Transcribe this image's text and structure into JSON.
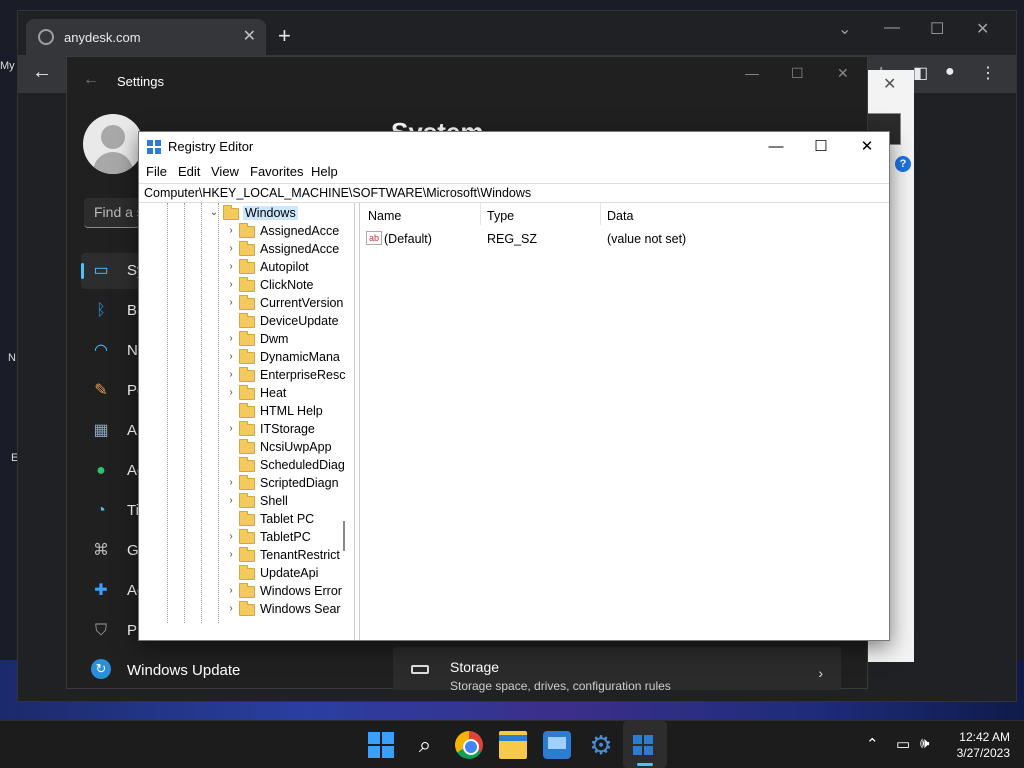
{
  "desktop": {
    "icon_labels": [
      "My",
      "N",
      "E"
    ]
  },
  "chrome": {
    "tab_title": "anydesk.com",
    "tab_close": "✕",
    "new_tab": "+",
    "back_arrow": "←",
    "icons": [
      "star-icon",
      "sidebar-icon",
      "profile-icon",
      "menu-icon"
    ]
  },
  "settings": {
    "window_title": "Settings",
    "back": "←",
    "page_title": "System",
    "search_placeholder": "Find a setting",
    "nav": [
      {
        "label": "System",
        "icon": "monitor-icon",
        "color": "#4cc2ff"
      },
      {
        "label": "Bluetooth & devices",
        "icon": "bluetooth-icon",
        "color": "#2a8fd8"
      },
      {
        "label": "Network & internet",
        "icon": "wifi-icon",
        "color": "#4cc2ff"
      },
      {
        "label": "Personalization",
        "icon": "brush-icon",
        "color": "#e8a24a"
      },
      {
        "label": "Apps",
        "icon": "apps-icon",
        "color": "#8aa4c8"
      },
      {
        "label": "Accounts",
        "icon": "person-icon",
        "color": "#2fbf71"
      },
      {
        "label": "Time & language",
        "icon": "globe-clock-icon",
        "color": "#4cc2ff"
      },
      {
        "label": "Gaming",
        "icon": "gamepad-icon",
        "color": "#bbbbbb"
      },
      {
        "label": "Accessibility",
        "icon": "accessibility-icon",
        "color": "#3aa0ff"
      },
      {
        "label": "Privacy & security",
        "icon": "shield-icon",
        "color": "#9aa0a6"
      }
    ],
    "windows_update": "Windows Update",
    "storage_title": "Storage",
    "storage_desc": "Storage space, drives, configuration rules"
  },
  "regedit": {
    "title": "Registry Editor",
    "menu": [
      "File",
      "Edit",
      "View",
      "Favorites",
      "Help"
    ],
    "address": "Computer\\HKEY_LOCAL_MACHINE\\SOFTWARE\\Microsoft\\Windows",
    "tree_root": "Windows",
    "tree_items": [
      {
        "label": "AssignedAcce",
        "expandable": true
      },
      {
        "label": "AssignedAcce",
        "expandable": true
      },
      {
        "label": "Autopilot",
        "expandable": true
      },
      {
        "label": "ClickNote",
        "expandable": true
      },
      {
        "label": "CurrentVersion",
        "expandable": true
      },
      {
        "label": "DeviceUpdate",
        "expandable": false
      },
      {
        "label": "Dwm",
        "expandable": true
      },
      {
        "label": "DynamicMana",
        "expandable": true
      },
      {
        "label": "EnterpriseResc",
        "expandable": true
      },
      {
        "label": "Heat",
        "expandable": true
      },
      {
        "label": "HTML Help",
        "expandable": false
      },
      {
        "label": "ITStorage",
        "expandable": true
      },
      {
        "label": "NcsiUwpApp",
        "expandable": false
      },
      {
        "label": "ScheduledDiag",
        "expandable": false
      },
      {
        "label": "ScriptedDiagn",
        "expandable": true
      },
      {
        "label": "Shell",
        "expandable": true
      },
      {
        "label": "Tablet PC",
        "expandable": false
      },
      {
        "label": "TabletPC",
        "expandable": true
      },
      {
        "label": "TenantRestrict",
        "expandable": true
      },
      {
        "label": "UpdateApi",
        "expandable": false
      },
      {
        "label": "Windows Error",
        "expandable": true
      },
      {
        "label": "Windows Sear",
        "expandable": true
      }
    ],
    "columns": [
      "Name",
      "Type",
      "Data"
    ],
    "values": [
      {
        "name": "(Default)",
        "type": "REG_SZ",
        "data": "(value not set)"
      }
    ]
  },
  "taskbar": {
    "apps": [
      "start-icon",
      "search-icon",
      "chrome-icon",
      "file-explorer-icon",
      "remote-desktop-icon",
      "settings-icon",
      "registry-editor-icon"
    ],
    "time": "12:42 AM",
    "date": "3/27/2023"
  }
}
